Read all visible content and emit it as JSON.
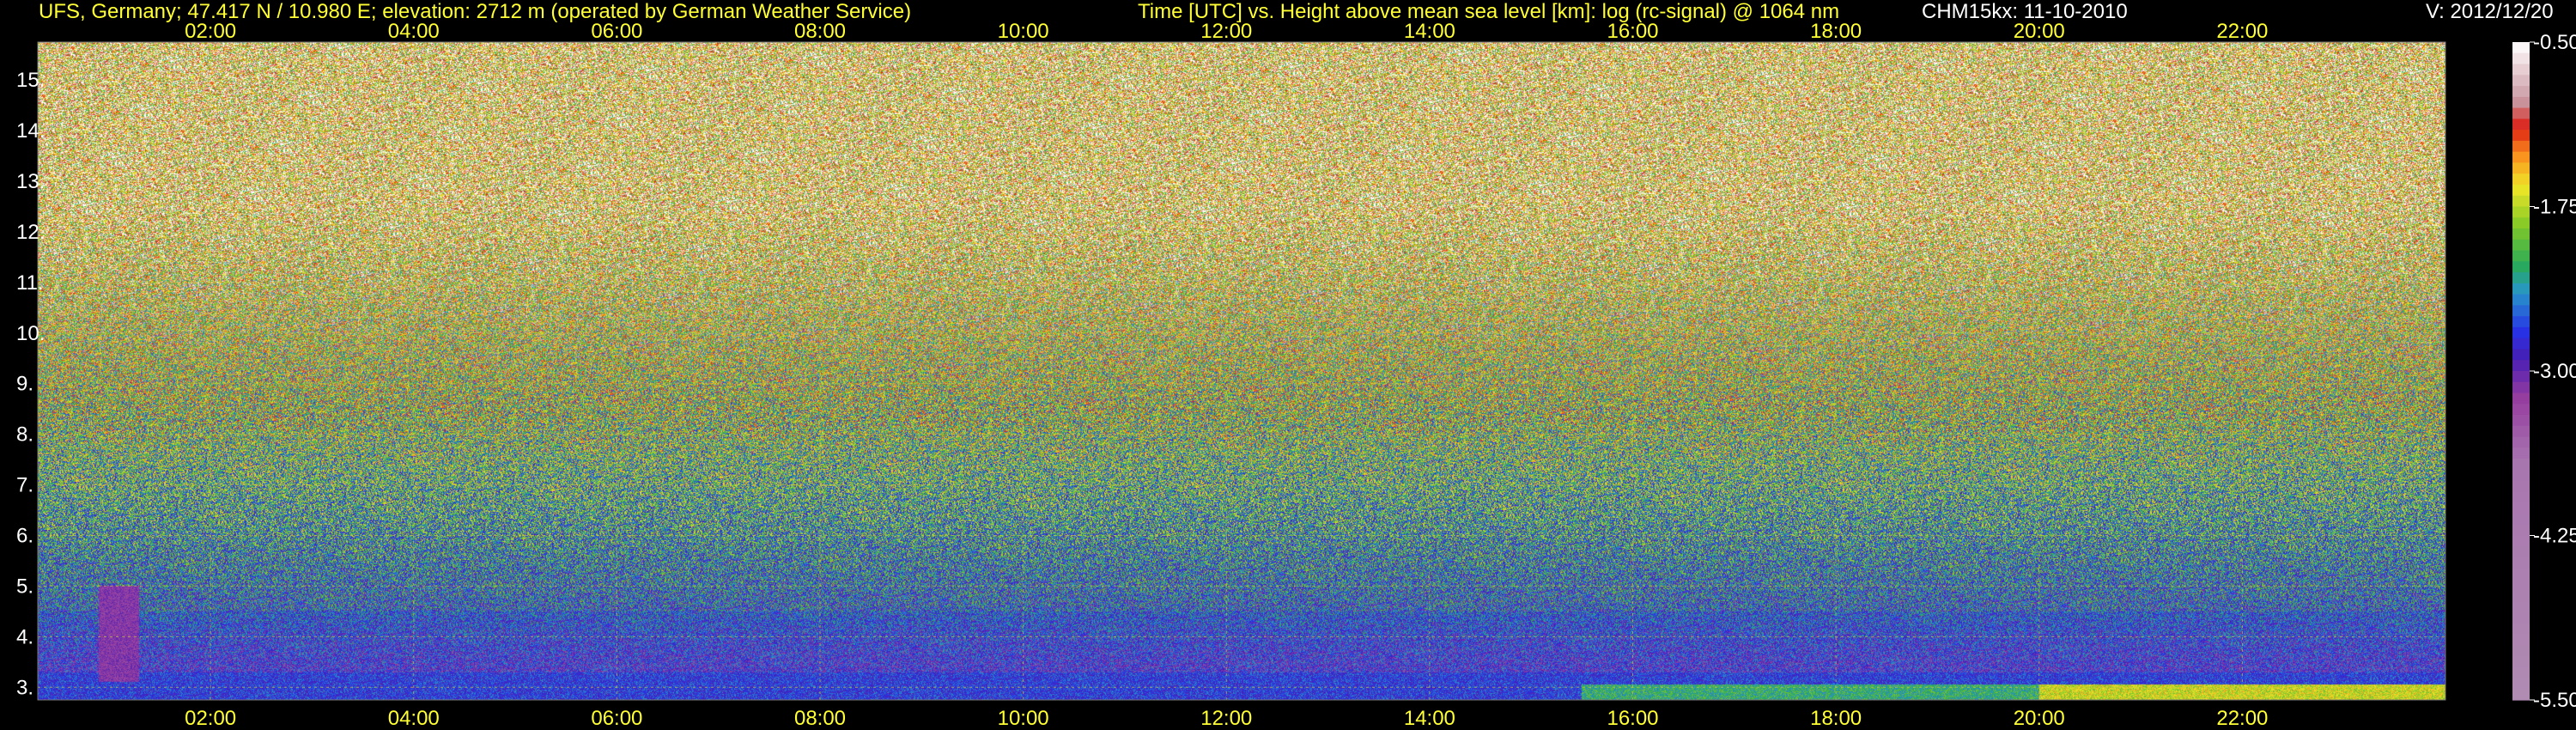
{
  "header": {
    "station": "UFS, Germany; 47.417 N / 10.980 E; elevation: 2712 m  (operated by German Weather Service)",
    "description": "Time [UTC] vs. Height above mean sea level [km]: log (rc-signal) @ 1064 nm",
    "instrument": "CHM15kx: 11-10-2010",
    "version": "V: 2012/12/20"
  },
  "chart_data": {
    "type": "heatmap",
    "title": "Time [UTC] vs. Height above mean sea level [km]: log (rc-signal) @ 1064 nm",
    "xlabel": "Time [UTC]",
    "ylabel": "Height above mean sea level [km]",
    "xlim": [
      0.3,
      24
    ],
    "ylim": [
      2.75,
      15.75
    ],
    "x_ticks": [
      "02:00",
      "04:00",
      "06:00",
      "08:00",
      "10:00",
      "12:00",
      "14:00",
      "16:00",
      "18:00",
      "20:00",
      "22:00"
    ],
    "x_tick_values": [
      2,
      4,
      6,
      8,
      10,
      12,
      14,
      16,
      18,
      20,
      22
    ],
    "y_ticks": [
      "3.",
      "4.",
      "5.",
      "6.",
      "7.",
      "8.",
      "9.",
      "10.",
      "11.",
      "12.",
      "13.",
      "14.",
      "15."
    ],
    "y_tick_values": [
      3,
      4,
      5,
      6,
      7,
      8,
      9,
      10,
      11,
      12,
      13,
      14,
      15
    ],
    "colorbar": {
      "ticks": [
        "-0.50",
        "-1.75",
        "-3.00",
        "-4.25",
        "-5.50"
      ],
      "tick_values": [
        -0.5,
        -1.75,
        -3.0,
        -4.25,
        -5.5
      ],
      "range": [
        -5.5,
        -0.5
      ]
    },
    "grid": true,
    "features": {
      "surface_layer_top_km": 3.3,
      "aerosol_layer_top_km": 4.5,
      "plume_time": 1.1,
      "plume_top_km": 5.0
    },
    "colors": {
      "axis_text": "#ffff33",
      "background": "#000000",
      "grid": "#c8c83c"
    }
  }
}
